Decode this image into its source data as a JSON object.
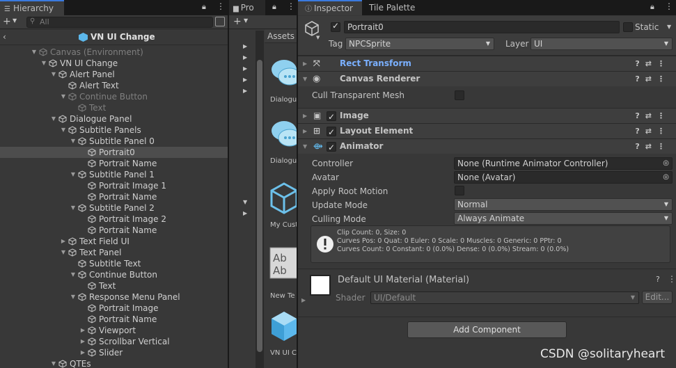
{
  "hierarchy": {
    "tab_label": "Hierarchy",
    "search_placeholder": "All",
    "scene_title": "VN UI Change",
    "rows": [
      {
        "label": "Canvas (Environment)",
        "depth": 0,
        "arrow": "open",
        "state": "dim"
      },
      {
        "label": "VN UI Change",
        "depth": 1,
        "arrow": "open",
        "state": "normal"
      },
      {
        "label": "Alert Panel",
        "depth": 2,
        "arrow": "open",
        "state": "normal"
      },
      {
        "label": "Alert Text",
        "depth": 3,
        "arrow": "none",
        "state": "normal"
      },
      {
        "label": "Continue Button",
        "depth": 3,
        "arrow": "open",
        "state": "dim"
      },
      {
        "label": "Text",
        "depth": 4,
        "arrow": "none",
        "state": "dim"
      },
      {
        "label": "Dialogue Panel",
        "depth": 2,
        "arrow": "open",
        "state": "normal"
      },
      {
        "label": "Subtitle Panels",
        "depth": 3,
        "arrow": "open",
        "state": "normal"
      },
      {
        "label": "Subtitle Panel 0",
        "depth": 4,
        "arrow": "open",
        "state": "normal"
      },
      {
        "label": "Portrait0",
        "depth": 5,
        "arrow": "none",
        "state": "selected"
      },
      {
        "label": "Portrait Name",
        "depth": 5,
        "arrow": "none",
        "state": "normal"
      },
      {
        "label": "Subtitle Panel 1",
        "depth": 4,
        "arrow": "open",
        "state": "normal"
      },
      {
        "label": "Portrait Image 1",
        "depth": 5,
        "arrow": "none",
        "state": "normal"
      },
      {
        "label": "Portrait Name",
        "depth": 5,
        "arrow": "none",
        "state": "normal"
      },
      {
        "label": "Subtitle Panel 2",
        "depth": 4,
        "arrow": "open",
        "state": "normal"
      },
      {
        "label": "Portrait Image 2",
        "depth": 5,
        "arrow": "none",
        "state": "normal"
      },
      {
        "label": "Portrait Name",
        "depth": 5,
        "arrow": "none",
        "state": "normal"
      },
      {
        "label": "Text Field UI",
        "depth": 3,
        "arrow": "closed",
        "state": "normal"
      },
      {
        "label": "Text Panel",
        "depth": 3,
        "arrow": "open",
        "state": "normal"
      },
      {
        "label": "Subtitle Text",
        "depth": 4,
        "arrow": "none",
        "state": "normal"
      },
      {
        "label": "Continue Button",
        "depth": 4,
        "arrow": "open",
        "state": "normal"
      },
      {
        "label": "Text",
        "depth": 5,
        "arrow": "none",
        "state": "normal"
      },
      {
        "label": "Response Menu Panel",
        "depth": 4,
        "arrow": "open",
        "state": "normal"
      },
      {
        "label": "Portrait Image",
        "depth": 5,
        "arrow": "none",
        "state": "normal"
      },
      {
        "label": "Portrait Name",
        "depth": 5,
        "arrow": "none",
        "state": "normal"
      },
      {
        "label": "Viewport",
        "depth": 5,
        "arrow": "closed",
        "state": "normal"
      },
      {
        "label": "Scrollbar Vertical",
        "depth": 5,
        "arrow": "closed",
        "state": "normal"
      },
      {
        "label": "Slider",
        "depth": 5,
        "arrow": "closed",
        "state": "normal"
      },
      {
        "label": "QTEs",
        "depth": 2,
        "arrow": "open",
        "state": "normal"
      }
    ]
  },
  "project": {
    "tab_label": "Pro",
    "breadcrumb": "Assets",
    "assets": [
      {
        "label": "Dialogue",
        "icon": "speech-bubble-icon"
      },
      {
        "label": "Dialogue",
        "icon": "speech-bubble-icon"
      },
      {
        "label": "My Cust",
        "icon": "cube-outline-icon"
      },
      {
        "label": "New Te",
        "icon": "text-asset-icon"
      },
      {
        "label": "VN UI C",
        "icon": "prefab-cube-icon"
      }
    ]
  },
  "inspector": {
    "tab_label": "Inspector",
    "tab2_label": "Tile Palette",
    "object_name": "Portrait0",
    "static_label": "Static",
    "tag_label": "Tag",
    "tag_value": "NPCSprite",
    "layer_label": "Layer",
    "layer_value": "UI",
    "components": {
      "rect_transform": "Rect Transform",
      "canvas_renderer": "Canvas Renderer",
      "cull_label": "Cull Transparent Mesh",
      "image": "Image",
      "layout_element": "Layout Element",
      "animator": "Animator"
    },
    "animator": {
      "controller_label": "Controller",
      "controller_value": "None (Runtime Animator Controller)",
      "avatar_label": "Avatar",
      "avatar_value": "None (Avatar)",
      "root_motion_label": "Apply Root Motion",
      "update_mode_label": "Update Mode",
      "update_mode_value": "Normal",
      "culling_mode_label": "Culling Mode",
      "culling_mode_value": "Always Animate",
      "info_lines": [
        "Clip Count: 0, Size: 0",
        "Curves Pos: 0 Quat: 0 Euler: 0 Scale: 0 Muscles: 0 Generic: 0 PPtr: 0",
        "Curves Count: 0 Constant: 0 (0.0%) Dense: 0 (0.0%) Stream: 0 (0.0%)"
      ]
    },
    "material": {
      "name": "Default UI Material (Material)",
      "shader_label": "Shader",
      "shader_value": "UI/Default",
      "edit_label": "Edit..."
    },
    "add_component": "Add Component"
  },
  "watermark": "CSDN @solitaryheart",
  "colors": {
    "accent_blue": "#3a7adf",
    "link_blue": "#7ab0ff",
    "selection": "#4d4d4d",
    "panel_bg": "#383838"
  }
}
